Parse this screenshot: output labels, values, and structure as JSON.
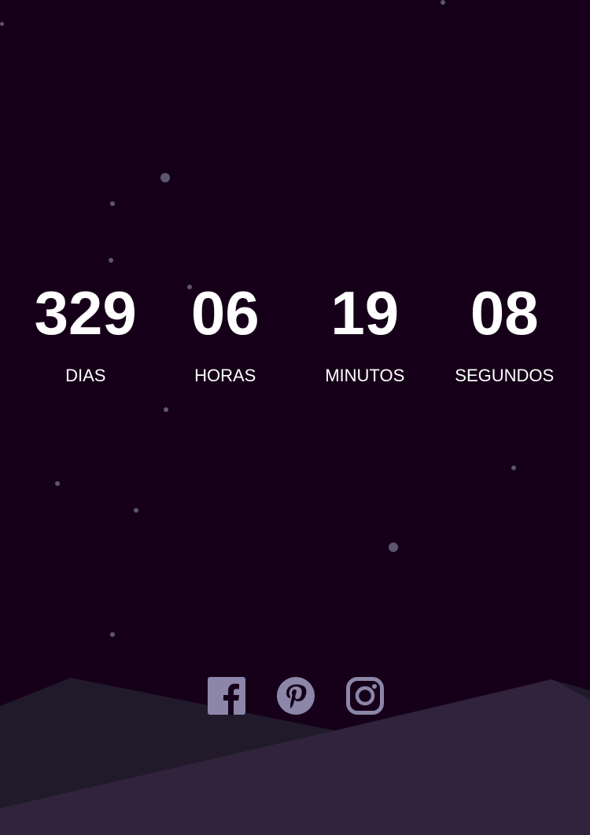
{
  "countdown": [
    {
      "value": "329",
      "label": "DIAS"
    },
    {
      "value": "06",
      "label": "HORAS"
    },
    {
      "value": "19",
      "label": "MINUTOS"
    },
    {
      "value": "08",
      "label": "SEGUNDOS"
    }
  ],
  "social": [
    {
      "name": "facebook-icon"
    },
    {
      "name": "pinterest-icon"
    },
    {
      "name": "instagram-icon"
    }
  ],
  "colors": {
    "background": "#160019",
    "text": "#ffffff",
    "icon": "#8c86a8",
    "hill_back": "#201a2a",
    "hill_front": "#31233c"
  }
}
